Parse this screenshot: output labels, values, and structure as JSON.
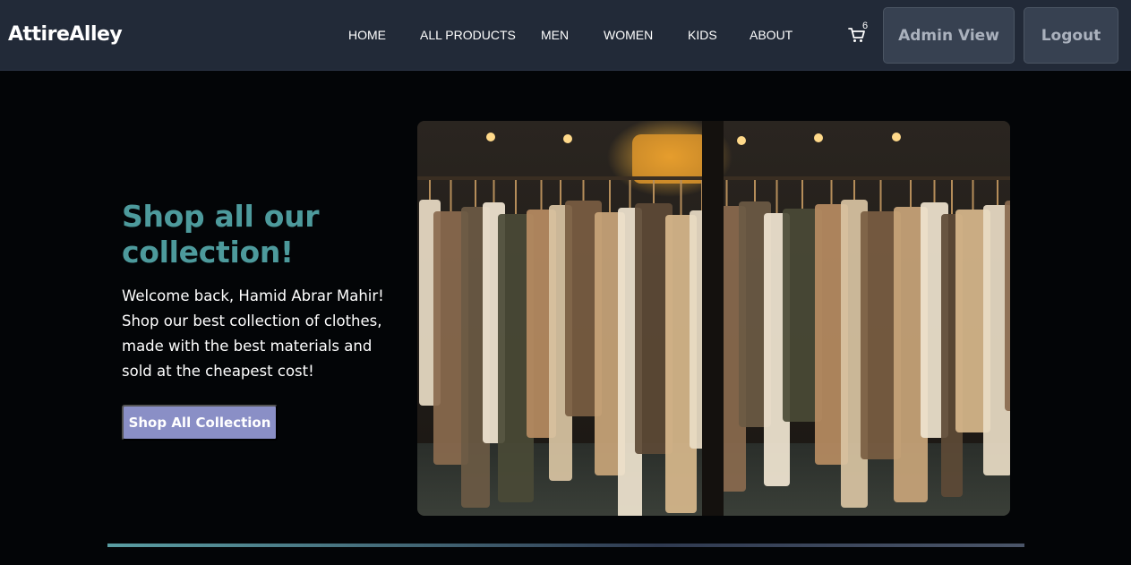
{
  "nav": {
    "brand": "AttireAlley",
    "links": [
      "HOME",
      "ALL PRODUCTS",
      "MEN",
      "WOMEN",
      "KIDS",
      "ABOUT"
    ],
    "cart_count": "6",
    "cart_icon": "cart-icon",
    "admin_label": "Admin View",
    "logout_label": "Logout"
  },
  "hero": {
    "title": "Shop all our collection!",
    "text": "Welcome back, Hamid Abrar Mahir! Shop our best collection of clothes, made with the best materials and sold at the cheapest cost!",
    "button_label": "Shop All Collection"
  },
  "colors": {
    "nav_bg": "#222a38",
    "page_bg": "#030507",
    "title": "#4d9a9c",
    "button": "#8a8fc6"
  }
}
